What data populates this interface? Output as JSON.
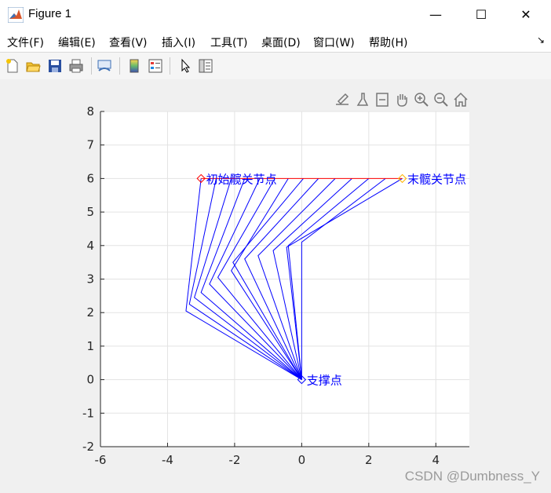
{
  "window": {
    "title": "Figure 1",
    "minimize_glyph": "—",
    "maximize_glyph": "☐",
    "close_glyph": "✕"
  },
  "menu": {
    "items": [
      "文件(F)",
      "编辑(E)",
      "查看(V)",
      "插入(I)",
      "工具(T)",
      "桌面(D)",
      "窗口(W)",
      "帮助(H)"
    ],
    "overflow_glyph": "↘"
  },
  "toolbar": {
    "icons": [
      "new-figure-icon",
      "open-file-icon",
      "save-icon",
      "print-icon",
      "link-plot-icon",
      "colorbar-icon",
      "legend-icon",
      "edit-plot-arrow-icon",
      "property-inspector-icon"
    ]
  },
  "axes_toolbar": {
    "icons": [
      "export-icon",
      "brush-icon",
      "data-tips-icon",
      "pan-hand-icon",
      "zoom-in-icon",
      "zoom-out-icon",
      "home-restore-icon"
    ]
  },
  "watermark": "CSDN @Dumbness_Y",
  "colors": {
    "links": "#0000ff",
    "trajectory": "#ff0000",
    "marker_start": "#ff0000",
    "marker_end": "#ffb300",
    "marker_support": "#0000ff",
    "labels": "#0000ff"
  },
  "chart_data": {
    "type": "line",
    "title": "",
    "xlabel": "",
    "ylabel": "",
    "xlim": [
      -6,
      5
    ],
    "ylim": [
      -2,
      8
    ],
    "xticks": [
      -6,
      -4,
      -2,
      0,
      2,
      4
    ],
    "yticks": [
      -2,
      -1,
      0,
      1,
      2,
      3,
      4,
      5,
      6,
      7,
      8
    ],
    "grid": true,
    "support": [
      0,
      0
    ],
    "linkages": [
      {
        "knee": [
          -3.45,
          2.05
        ],
        "end": [
          -3.0,
          6.0
        ]
      },
      {
        "knee": [
          -3.35,
          2.25
        ],
        "end": [
          -2.55,
          6.0
        ]
      },
      {
        "knee": [
          -3.2,
          2.45
        ],
        "end": [
          -2.1,
          6.0
        ]
      },
      {
        "knee": [
          -3.0,
          2.6
        ],
        "end": [
          -1.7,
          6.0
        ]
      },
      {
        "knee": [
          -2.75,
          2.85
        ],
        "end": [
          -1.25,
          6.0
        ]
      },
      {
        "knee": [
          -2.5,
          3.05
        ],
        "end": [
          -0.8,
          6.0
        ]
      },
      {
        "knee": [
          -2.1,
          3.25
        ],
        "end": [
          -0.4,
          6.0
        ]
      },
      {
        "knee": [
          -2.05,
          3.5
        ],
        "end": [
          0.05,
          6.0
        ]
      },
      {
        "knee": [
          -1.7,
          3.6
        ],
        "end": [
          0.5,
          6.0
        ]
      },
      {
        "knee": [
          -1.3,
          3.7
        ],
        "end": [
          1.0,
          6.0
        ]
      },
      {
        "knee": [
          -0.85,
          3.85
        ],
        "end": [
          1.5,
          6.0
        ]
      },
      {
        "knee": [
          -0.4,
          4.0
        ],
        "end": [
          2.0,
          6.0
        ]
      },
      {
        "knee": [
          0.0,
          4.1
        ],
        "end": [
          2.5,
          6.0
        ]
      },
      {
        "knee": [
          -0.45,
          3.95
        ],
        "end": [
          3.0,
          6.0
        ]
      }
    ],
    "trajectory": {
      "x": [
        -3.0,
        3.0
      ],
      "y": [
        6.0,
        6.0
      ]
    },
    "markers": [
      {
        "name": "start",
        "x": -3.0,
        "y": 6.0
      },
      {
        "name": "end",
        "x": 3.0,
        "y": 6.0
      },
      {
        "name": "support",
        "x": 0.0,
        "y": 0.0
      }
    ],
    "annotations": [
      {
        "text": "初始髋关节点",
        "x": -2.85,
        "y": 6.0
      },
      {
        "text": "末髋关节点",
        "x": 3.15,
        "y": 6.0
      },
      {
        "text": "支撑点",
        "x": 0.15,
        "y": 0.0
      }
    ]
  }
}
